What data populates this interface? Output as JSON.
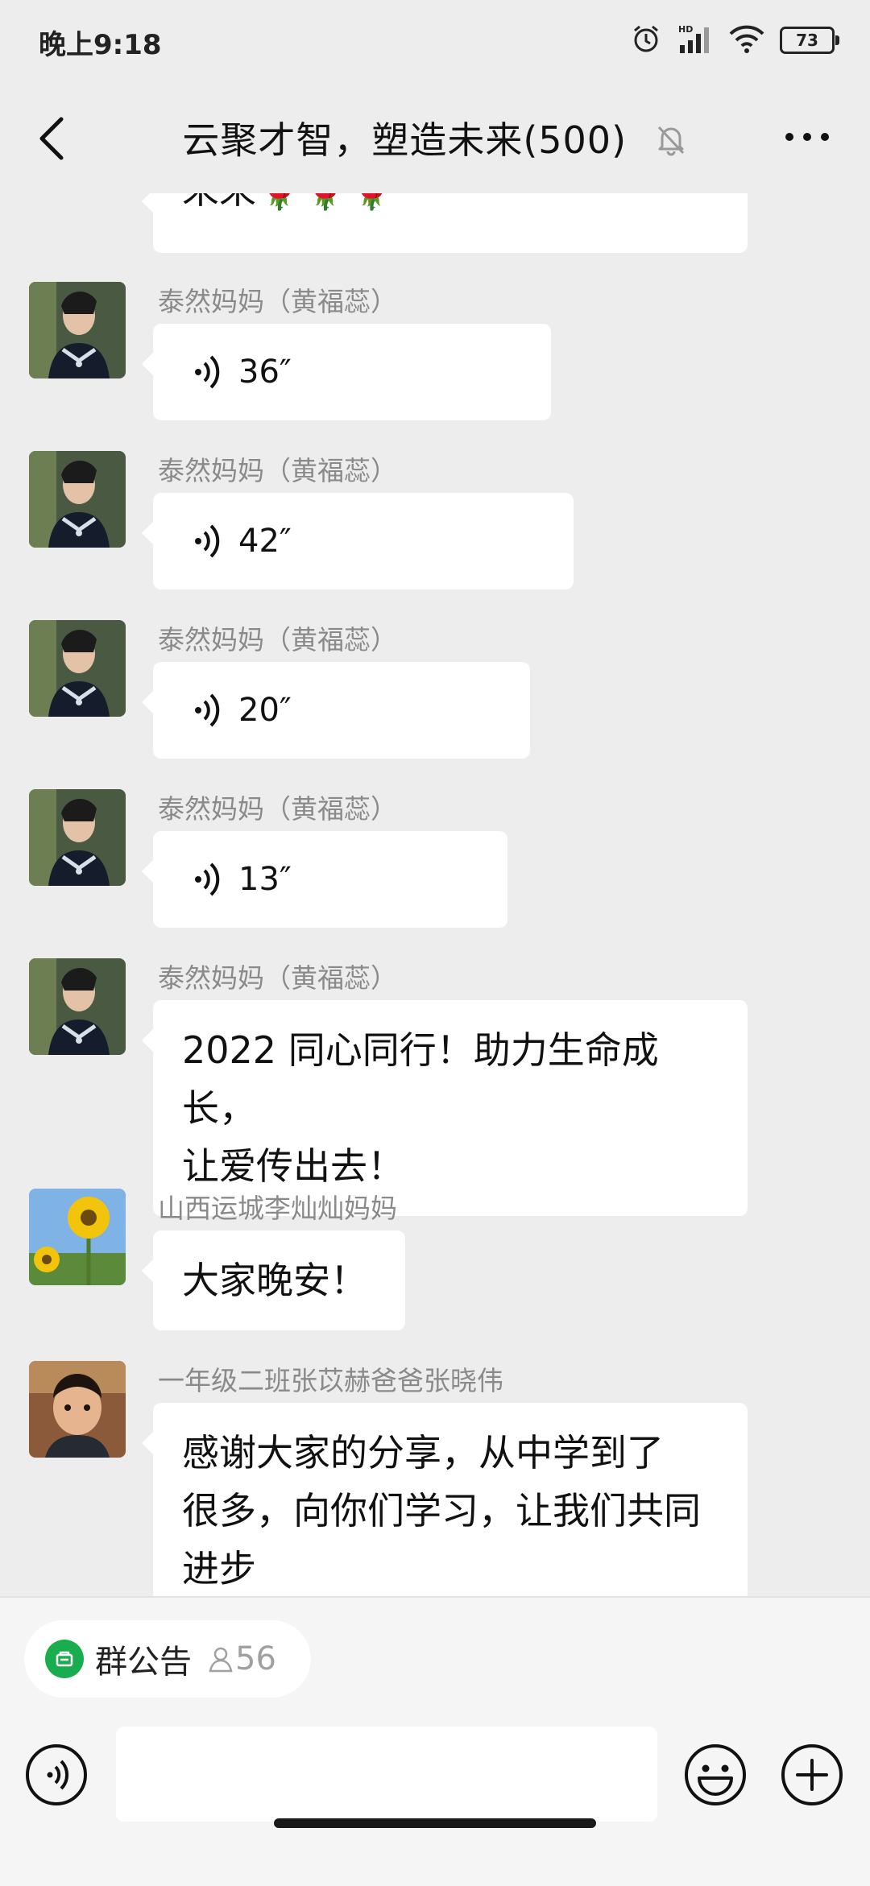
{
  "status_bar": {
    "time": "晚上9:18",
    "battery": "73",
    "icons": [
      "alarm-icon",
      "hd-signal-icon",
      "wifi-icon",
      "battery-icon"
    ]
  },
  "nav": {
    "title": "云聚才智，塑造未来(500)",
    "icons": [
      "back-icon",
      "mute-bell-icon",
      "more-icon"
    ]
  },
  "messages": [
    {
      "type": "text",
      "text": "未来🌹🌹🌹"
    },
    {
      "sender": "泰然妈妈（黄福蕊）",
      "type": "voice",
      "duration": "36″"
    },
    {
      "sender": "泰然妈妈（黄福蕊）",
      "type": "voice",
      "duration": "42″"
    },
    {
      "sender": "泰然妈妈（黄福蕊）",
      "type": "voice",
      "duration": "20″"
    },
    {
      "sender": "泰然妈妈（黄福蕊）",
      "type": "voice",
      "duration": "13″"
    },
    {
      "sender": "泰然妈妈（黄福蕊）",
      "type": "text",
      "lines": [
        "2022 同心同行！助力生命成长，",
        "让爱传出去！"
      ]
    },
    {
      "sender": "山西运城李灿灿妈妈",
      "type": "text",
      "lines": [
        "大家晚安！"
      ]
    },
    {
      "sender": "一年级二班张苡赫爸爸张晓伟",
      "type": "text",
      "lines": [
        "感谢大家的分享，从中学到了",
        "很多，向你们学习，让我们共同",
        "进步"
      ]
    }
  ],
  "bottom": {
    "notice_label": "群公告",
    "member_count": "56",
    "icons": [
      "voice-input-icon",
      "emoji-icon",
      "plus-icon"
    ]
  },
  "colors": {
    "accent_green": "#1aad4f",
    "background": "#ededed",
    "bubble": "#ffffff"
  }
}
